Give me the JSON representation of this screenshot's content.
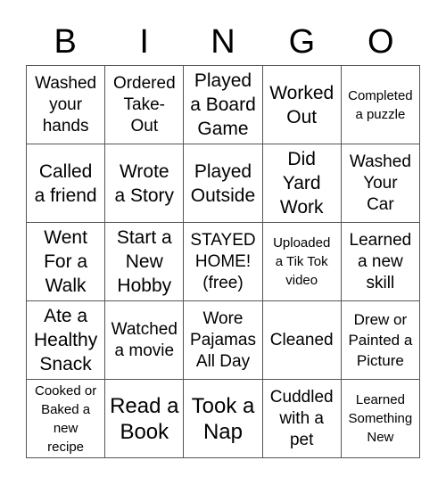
{
  "header": {
    "letters": [
      "B",
      "I",
      "N",
      "G",
      "O"
    ]
  },
  "cells": [
    {
      "text": "Washed\nyour\nhands",
      "size": "s-m"
    },
    {
      "text": "Ordered\nTake-\nOut",
      "size": "s-m"
    },
    {
      "text": "Played\na Board\nGame",
      "size": "s-l"
    },
    {
      "text": "Worked\nOut",
      "size": "s-l"
    },
    {
      "text": "Completed\na puzzle",
      "size": "s-xs"
    },
    {
      "text": "Called\na friend",
      "size": "s-l"
    },
    {
      "text": "Wrote\na Story",
      "size": "s-l"
    },
    {
      "text": "Played\nOutside",
      "size": "s-l"
    },
    {
      "text": "Did\nYard\nWork",
      "size": "s-l"
    },
    {
      "text": "Washed\nYour\nCar",
      "size": "s-m"
    },
    {
      "text": "Went\nFor a\nWalk",
      "size": "s-l"
    },
    {
      "text": "Start a\nNew\nHobby",
      "size": "s-l"
    },
    {
      "text": "STAYED\nHOME!\n(free)",
      "size": "s-m"
    },
    {
      "text": "Uploaded\na Tik Tok\nvideo",
      "size": "s-xs"
    },
    {
      "text": "Learned\na new\nskill",
      "size": "s-m"
    },
    {
      "text": "Ate a\nHealthy\nSnack",
      "size": "s-l"
    },
    {
      "text": "Watched\na movie",
      "size": "s-m"
    },
    {
      "text": "Wore\nPajamas\nAll Day",
      "size": "s-m"
    },
    {
      "text": "Cleaned",
      "size": "s-m"
    },
    {
      "text": "Drew or\nPainted a\nPicture",
      "size": "s-s"
    },
    {
      "text": "Cooked or\nBaked a\nnew\nrecipe",
      "size": "s-xs"
    },
    {
      "text": "Read a\nBook",
      "size": "s-xl"
    },
    {
      "text": "Took a\nNap",
      "size": "s-xl"
    },
    {
      "text": "Cuddled\nwith a\npet",
      "size": "s-m"
    },
    {
      "text": "Learned\nSomething\nNew",
      "size": "s-xs"
    }
  ]
}
